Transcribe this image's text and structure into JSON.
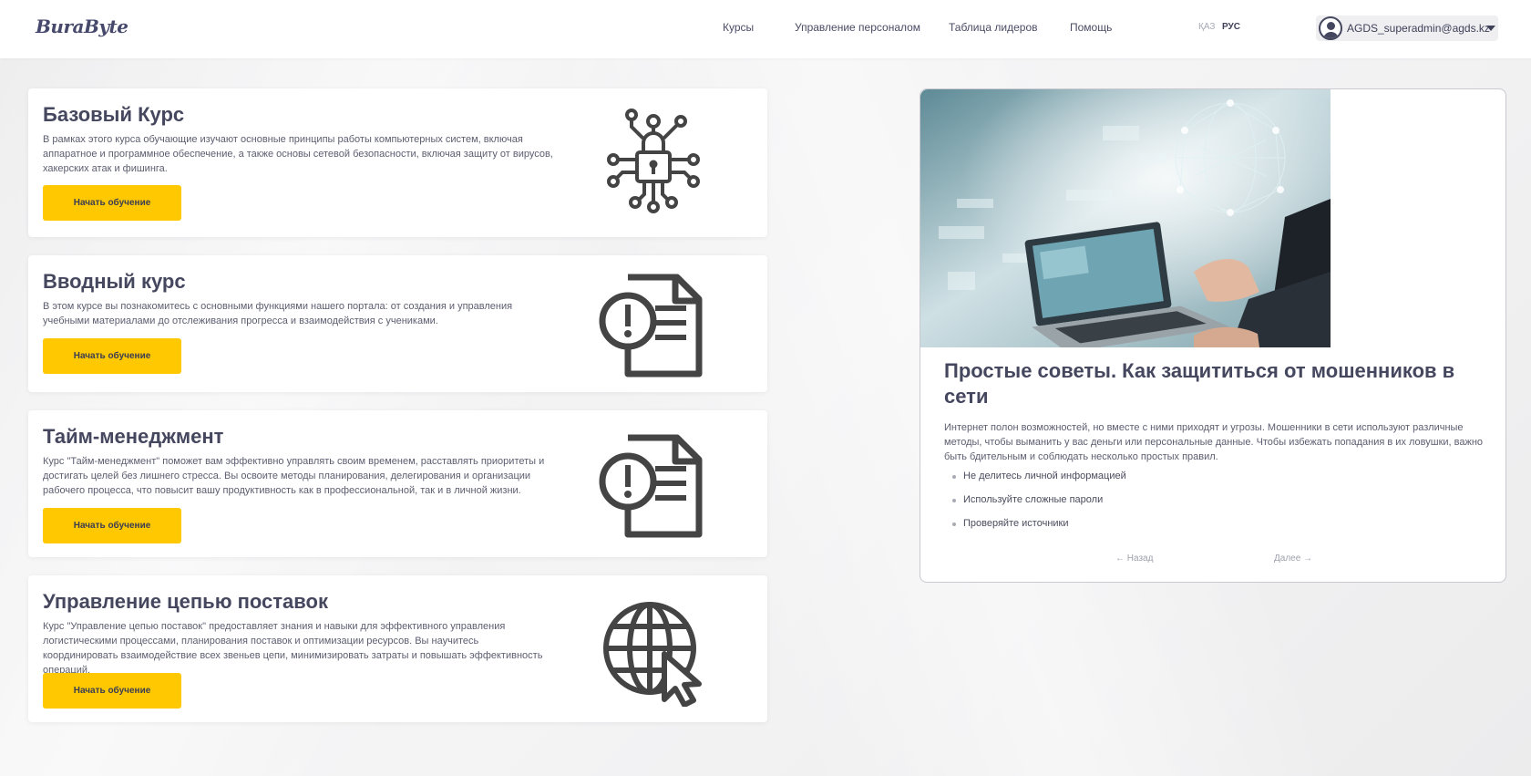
{
  "header": {
    "logo": "BuraByte",
    "nav": [
      "Курсы",
      "Управление персоналом",
      "Таблица лидеров",
      "Помощь"
    ],
    "lang": {
      "kz": "ҚАЗ",
      "ru": "РУС"
    },
    "user_email": "AGDS_superadmin@agds.kz"
  },
  "courses": [
    {
      "title": "Базовый Курс",
      "description": "В рамках этого курса обучающие изучают основные принципы работы компьютерных систем, включая аппаратное и программное обеспечение, а также основы сетевой безопасности, включая защиту от вирусов, хакерских атак и фишинга.",
      "button": "Начать обучение",
      "icon": "network-lock-icon"
    },
    {
      "title": "Вводный курс",
      "description": "В этом курсе вы познакомитесь с основными функциями нашего портала: от создания и управления учебными материалами до отслеживания прогресса и взаимодействия с учениками.",
      "button": "Начать обучение",
      "icon": "document-alert-icon"
    },
    {
      "title": "Тайм-менеджмент",
      "description": "Курс \"Тайм-менеджмент\" поможет вам эффективно управлять своим временем, расставлять приоритеты и достигать целей без лишнего стресса. Вы освоите методы планирования, делегирования и организации рабочего процесса, что повысит вашу продуктивность как в профессиональной, так и в личной жизни.",
      "button": "Начать обучение",
      "icon": "document-alert-icon"
    },
    {
      "title": "Управление цепью поставок",
      "description": "Курс \"Управление цепью поставок\" предоставляет знания и навыки для эффективного управления логистическими процессами, планирования поставок и оптимизации ресурсов. Вы научитесь координировать взаимодействие всех звеньев цепи, минимизировать затраты и повышать эффективность операций.",
      "button": "Начать обучение",
      "icon": "globe-cursor-icon"
    }
  ],
  "tips_panel": {
    "title": "Простые советы. Как защититься от мошенников в сети",
    "intro": "Интернет полон возможностей, но вместе с ними приходят и угрозы. Мошенники в сети используют различные методы, чтобы выманить у вас деньги или персональные данные. Чтобы избежать попадания в их ловушки, важно быть бдительным и соблюдать несколько простых правил.",
    "items": [
      "Не делитесь личной информацией",
      "Используйте сложные пароли",
      "Проверяйте источники"
    ],
    "prev": "← Назад",
    "next": "Далее →",
    "image": "hands-laptop-network-globe-image"
  },
  "colors": {
    "accent": "#ffc800",
    "text": "#45475f",
    "background": "#f1f1f2"
  }
}
